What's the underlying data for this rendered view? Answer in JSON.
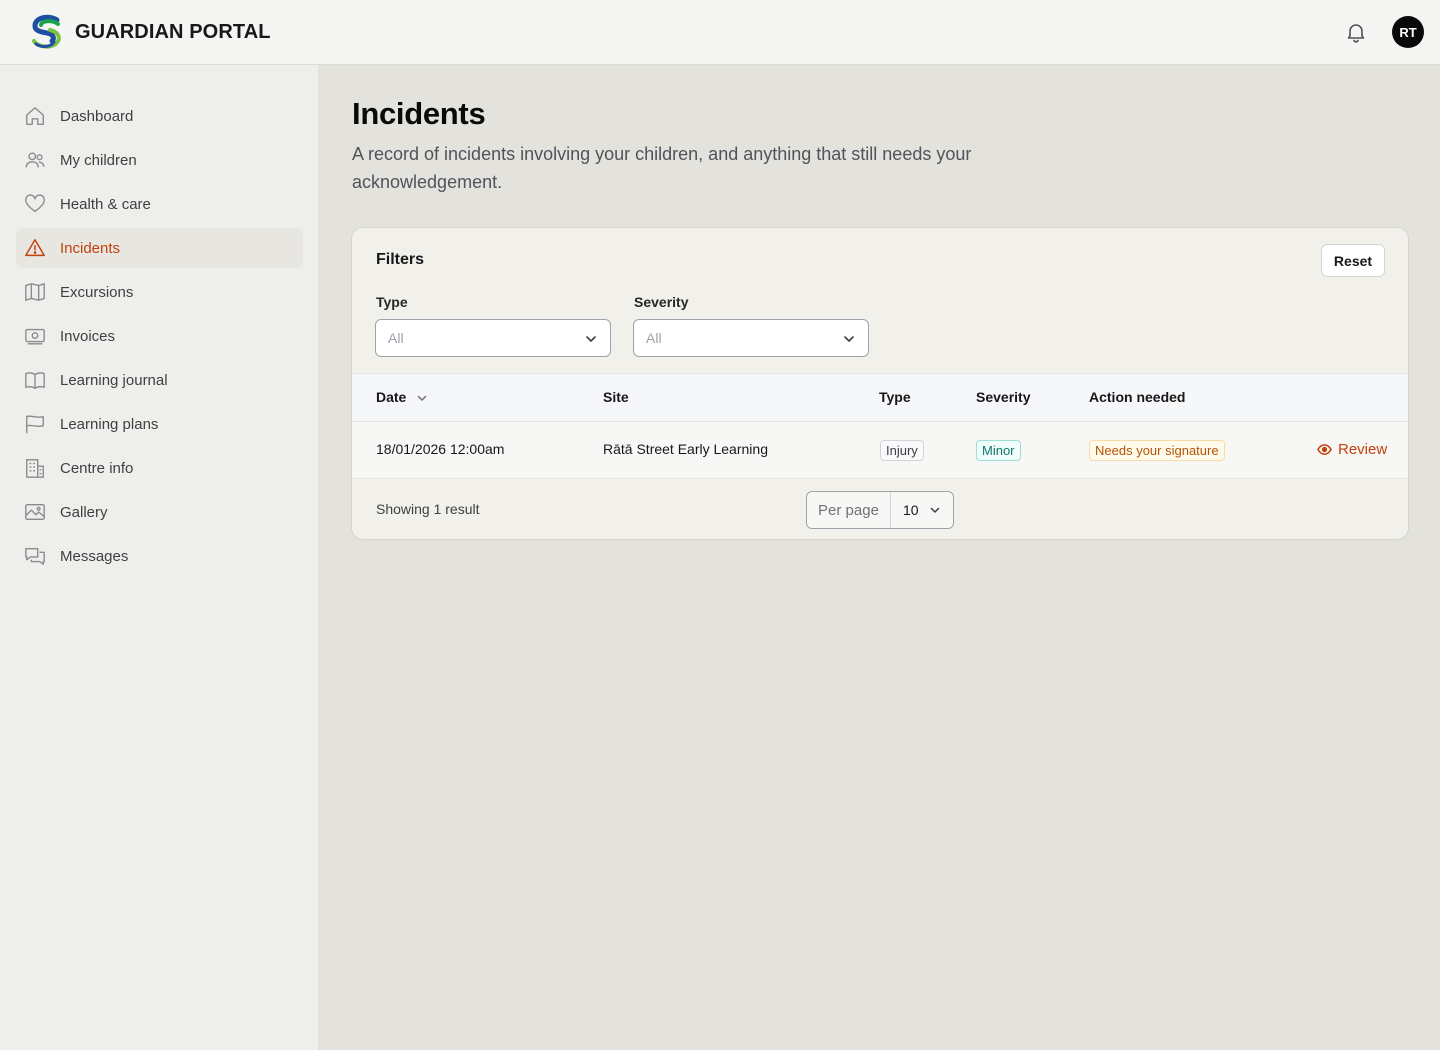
{
  "header": {
    "brand_name": "GUARDIAN PORTAL",
    "avatar_initials": "RT"
  },
  "sidebar": {
    "items": [
      {
        "label": "Dashboard",
        "icon": "home-icon"
      },
      {
        "label": "My children",
        "icon": "users-icon"
      },
      {
        "label": "Health & care",
        "icon": "heart-icon"
      },
      {
        "label": "Incidents",
        "icon": "warning-icon",
        "active": true
      },
      {
        "label": "Excursions",
        "icon": "map-icon"
      },
      {
        "label": "Invoices",
        "icon": "banknote-icon"
      },
      {
        "label": "Learning journal",
        "icon": "book-icon"
      },
      {
        "label": "Learning plans",
        "icon": "flag-icon"
      },
      {
        "label": "Centre info",
        "icon": "building-icon"
      },
      {
        "label": "Gallery",
        "icon": "image-icon"
      },
      {
        "label": "Messages",
        "icon": "chat-icon"
      }
    ]
  },
  "main": {
    "title": "Incidents",
    "subtitle": "A record of incidents involving your children, and anything that still needs your acknowledgement."
  },
  "filters": {
    "title": "Filters",
    "reset_label": "Reset",
    "type_label": "Type",
    "type_value": "All",
    "severity_label": "Severity",
    "severity_value": "All"
  },
  "table": {
    "columns": [
      "Date",
      "Site",
      "Type",
      "Severity",
      "Action needed"
    ],
    "rows": [
      {
        "date": "18/01/2026 12:00am",
        "site": "Rātā Street Early Learning",
        "type": "Injury",
        "severity": "Minor",
        "action": "Needs your signature",
        "review_label": "Review"
      }
    ]
  },
  "footer": {
    "showing_text": "Showing 1 result",
    "per_page_label": "Per page",
    "per_page_value": "10"
  },
  "colors": {
    "accent": "#c2410c",
    "minor_badge": "#0f766e",
    "action_badge": "#b45309"
  }
}
